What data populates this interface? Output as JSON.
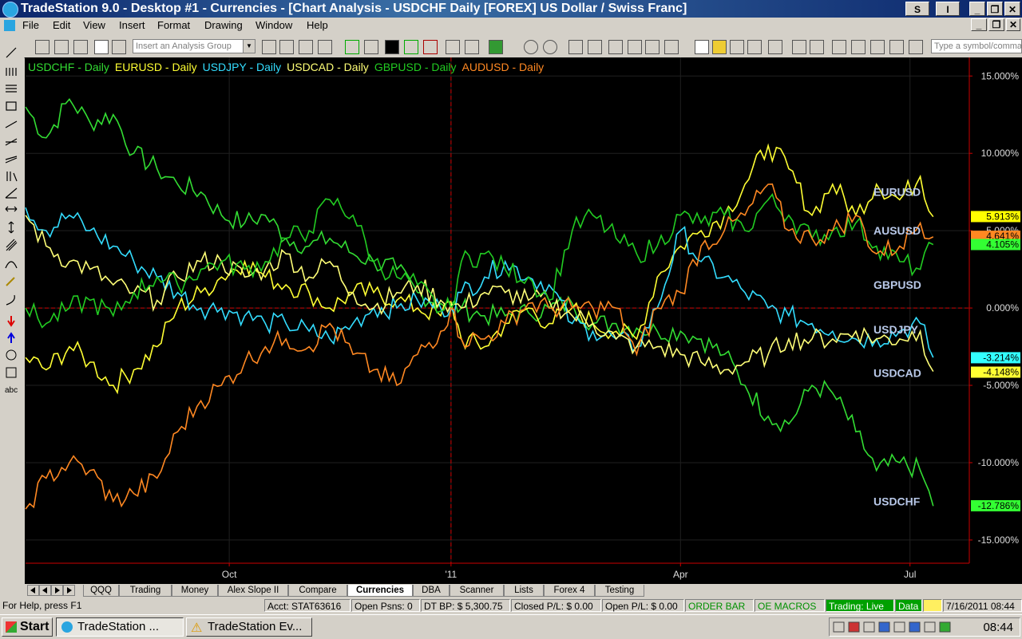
{
  "window": {
    "title": "TradeStation 9.0 - Desktop #1 - Currencies - [Chart Analysis - USDCHF Daily [FOREX] US Dollar / Swiss Franc]",
    "btn_s": "S",
    "btn_i": "I",
    "minimize": "_",
    "restore": "❐",
    "close": "✕"
  },
  "menu": [
    "File",
    "Edit",
    "View",
    "Insert",
    "Format",
    "Drawing",
    "Window",
    "Help"
  ],
  "toolbar": {
    "analysis_group_placeholder": "Insert an Analysis Group",
    "symbol_placeholder": "Type a symbol/command"
  },
  "left_tools": {
    "text_tool": "abc"
  },
  "chart_data": {
    "type": "line",
    "yunit": "percent change",
    "yticks": [
      "15.000%",
      "10.000%",
      "5.000%",
      "0.000%",
      "-5.000%",
      "-10.000%",
      "-15.000%"
    ],
    "ytick_values": [
      15,
      10,
      5,
      0,
      -5,
      -10,
      -15
    ],
    "ylim": [
      -16.5,
      16.2
    ],
    "xlabels": [
      "Oct",
      "'11",
      "Apr",
      "Jul"
    ],
    "xlabel_days": [
      79,
      165,
      254,
      343
    ],
    "xlim": [
      0,
      366
    ],
    "reference_line_value": 0,
    "reference_day": 165,
    "grid": true,
    "legend_placement": "top-left",
    "x": [
      0,
      8,
      17,
      25,
      34,
      42,
      51,
      59,
      68,
      76,
      85,
      93,
      101,
      110,
      118,
      127,
      135,
      144,
      152,
      161,
      165,
      169,
      178,
      186,
      195,
      203,
      212,
      220,
      229,
      237,
      245,
      254,
      262,
      271,
      279,
      288,
      296,
      305,
      313,
      322,
      330,
      339,
      347,
      352
    ],
    "series": [
      {
        "name": "USDCHF - Daily",
        "short": "USDCHF",
        "color": "#33dd33",
        "last_label": "-12.786%",
        "values": [
          13,
          11,
          13.5,
          12,
          12.5,
          10,
          9,
          8,
          7.5,
          6,
          5.5,
          6,
          4.5,
          4,
          4.5,
          3.5,
          3,
          2.5,
          1,
          0.3,
          0.2,
          0,
          -0.5,
          -0.5,
          -0.3,
          0,
          0.3,
          -1,
          -1,
          -1.3,
          -1.5,
          -1.5,
          -2,
          -3,
          -5,
          -7,
          -7.5,
          -5,
          -5.5,
          -8,
          -10.5,
          -10,
          -10.5,
          -12.8
        ]
      },
      {
        "name": "EURUSD - Daily",
        "short": "EURUSD",
        "color": "#ffff33",
        "last_label": "5.913%",
        "values": [
          -3.2,
          -4,
          -2.5,
          -3.5,
          -5,
          -4,
          -2.5,
          0,
          1,
          2,
          3,
          2,
          1.5,
          1,
          0,
          1,
          1,
          0.5,
          0,
          -0.5,
          0.4,
          -2,
          -2.5,
          -1,
          0,
          -1,
          0,
          -1,
          -1.5,
          -2,
          2,
          4,
          5,
          6,
          8,
          10.5,
          9,
          6,
          8,
          6,
          8,
          7,
          8.5,
          5.9
        ]
      },
      {
        "name": "USDJPY - Daily",
        "short": "USDJPY",
        "color": "#33ddff",
        "last_label": "-3.214%",
        "values": [
          6.5,
          5,
          6,
          5,
          4,
          3,
          2,
          1,
          0,
          0,
          -0.5,
          -1,
          -1,
          -1.5,
          -2,
          -1,
          0,
          0,
          0.5,
          0,
          0,
          1,
          2,
          3,
          2,
          1.5,
          -1,
          -1.5,
          -2,
          -2.5,
          0,
          5,
          3,
          2,
          1,
          0,
          -0.5,
          -1,
          -1.5,
          -2,
          -2,
          -1.5,
          -1,
          -3.2
        ]
      },
      {
        "name": "USDCAD - Daily",
        "short": "USDCAD",
        "color": "#ffff77",
        "last_label": "-4.148%",
        "values": [
          6,
          4,
          3,
          2.5,
          1.5,
          1,
          0.5,
          2,
          3,
          3,
          2,
          2.5,
          3.5,
          2,
          3,
          1,
          0,
          1,
          1.5,
          0.5,
          0.2,
          0,
          1,
          1,
          0.5,
          0.5,
          -0.5,
          -1,
          -2,
          -2.5,
          -2.5,
          -3,
          -3.5,
          -4,
          -3.5,
          -3,
          -2,
          -2,
          -2,
          -1.5,
          -2,
          -2,
          -1.5,
          -4.1
        ]
      },
      {
        "name": "GBPUSD - Daily",
        "short": "GBPUSD",
        "color": "#22cc22",
        "last_label": "4.105%",
        "values": [
          0,
          -1,
          0,
          0.5,
          -0.5,
          1,
          2,
          1.5,
          2.5,
          3,
          2.5,
          3,
          4.5,
          5,
          7,
          6,
          3,
          2,
          1.5,
          -0.2,
          0,
          3,
          3.5,
          2.5,
          2,
          0.5,
          5,
          6,
          4.5,
          3.5,
          4,
          6,
          5.5,
          6,
          5,
          7,
          6,
          4.5,
          5,
          5.5,
          4,
          3,
          2.5,
          4.1
        ]
      },
      {
        "name": "AUDUSD - Daily",
        "short": "AUSUSD",
        "color": "#ff8822",
        "last_label": "4.641%",
        "values": [
          -13,
          -11,
          -10,
          -10.5,
          -12.5,
          -12,
          -11,
          -8,
          -6,
          -5,
          -3.5,
          -2.5,
          -2,
          -2.5,
          -1,
          -3,
          -4,
          -5,
          -3,
          -1.5,
          0,
          -2,
          -2,
          -1,
          0.3,
          0,
          0,
          0,
          0,
          -3,
          0,
          1,
          4,
          5,
          6,
          8,
          5,
          4.5,
          5,
          6,
          3.5,
          4,
          5.5,
          4.6
        ]
      }
    ],
    "price_scale_label": "5.000%"
  },
  "tabs": [
    "QQQ",
    "Trading",
    "Money",
    "Alex Slope II",
    "Compare",
    "Currencies",
    "DBA",
    "Scanner",
    "Lists",
    "Forex 4",
    "Testing"
  ],
  "status": {
    "help": "For Help, press F1",
    "acct": "Acct: STAT63616",
    "open_psns": "Open Psns: 0",
    "dt_bp": "DT BP: $ 5,300.75",
    "closed_pl": "Closed P/L: $ 0.00",
    "open_pl": "Open P/L: $ 0.00",
    "order_bar": "ORDER BAR",
    "oe_macros": "OE MACROS",
    "trading": "Trading: Live",
    "data": "Data",
    "datetime": "7/16/2011 08:44"
  },
  "taskbar": {
    "start": "Start",
    "task1": "TradeStation ...",
    "task2": "TradeStation Ev...",
    "clock": "08:44"
  }
}
